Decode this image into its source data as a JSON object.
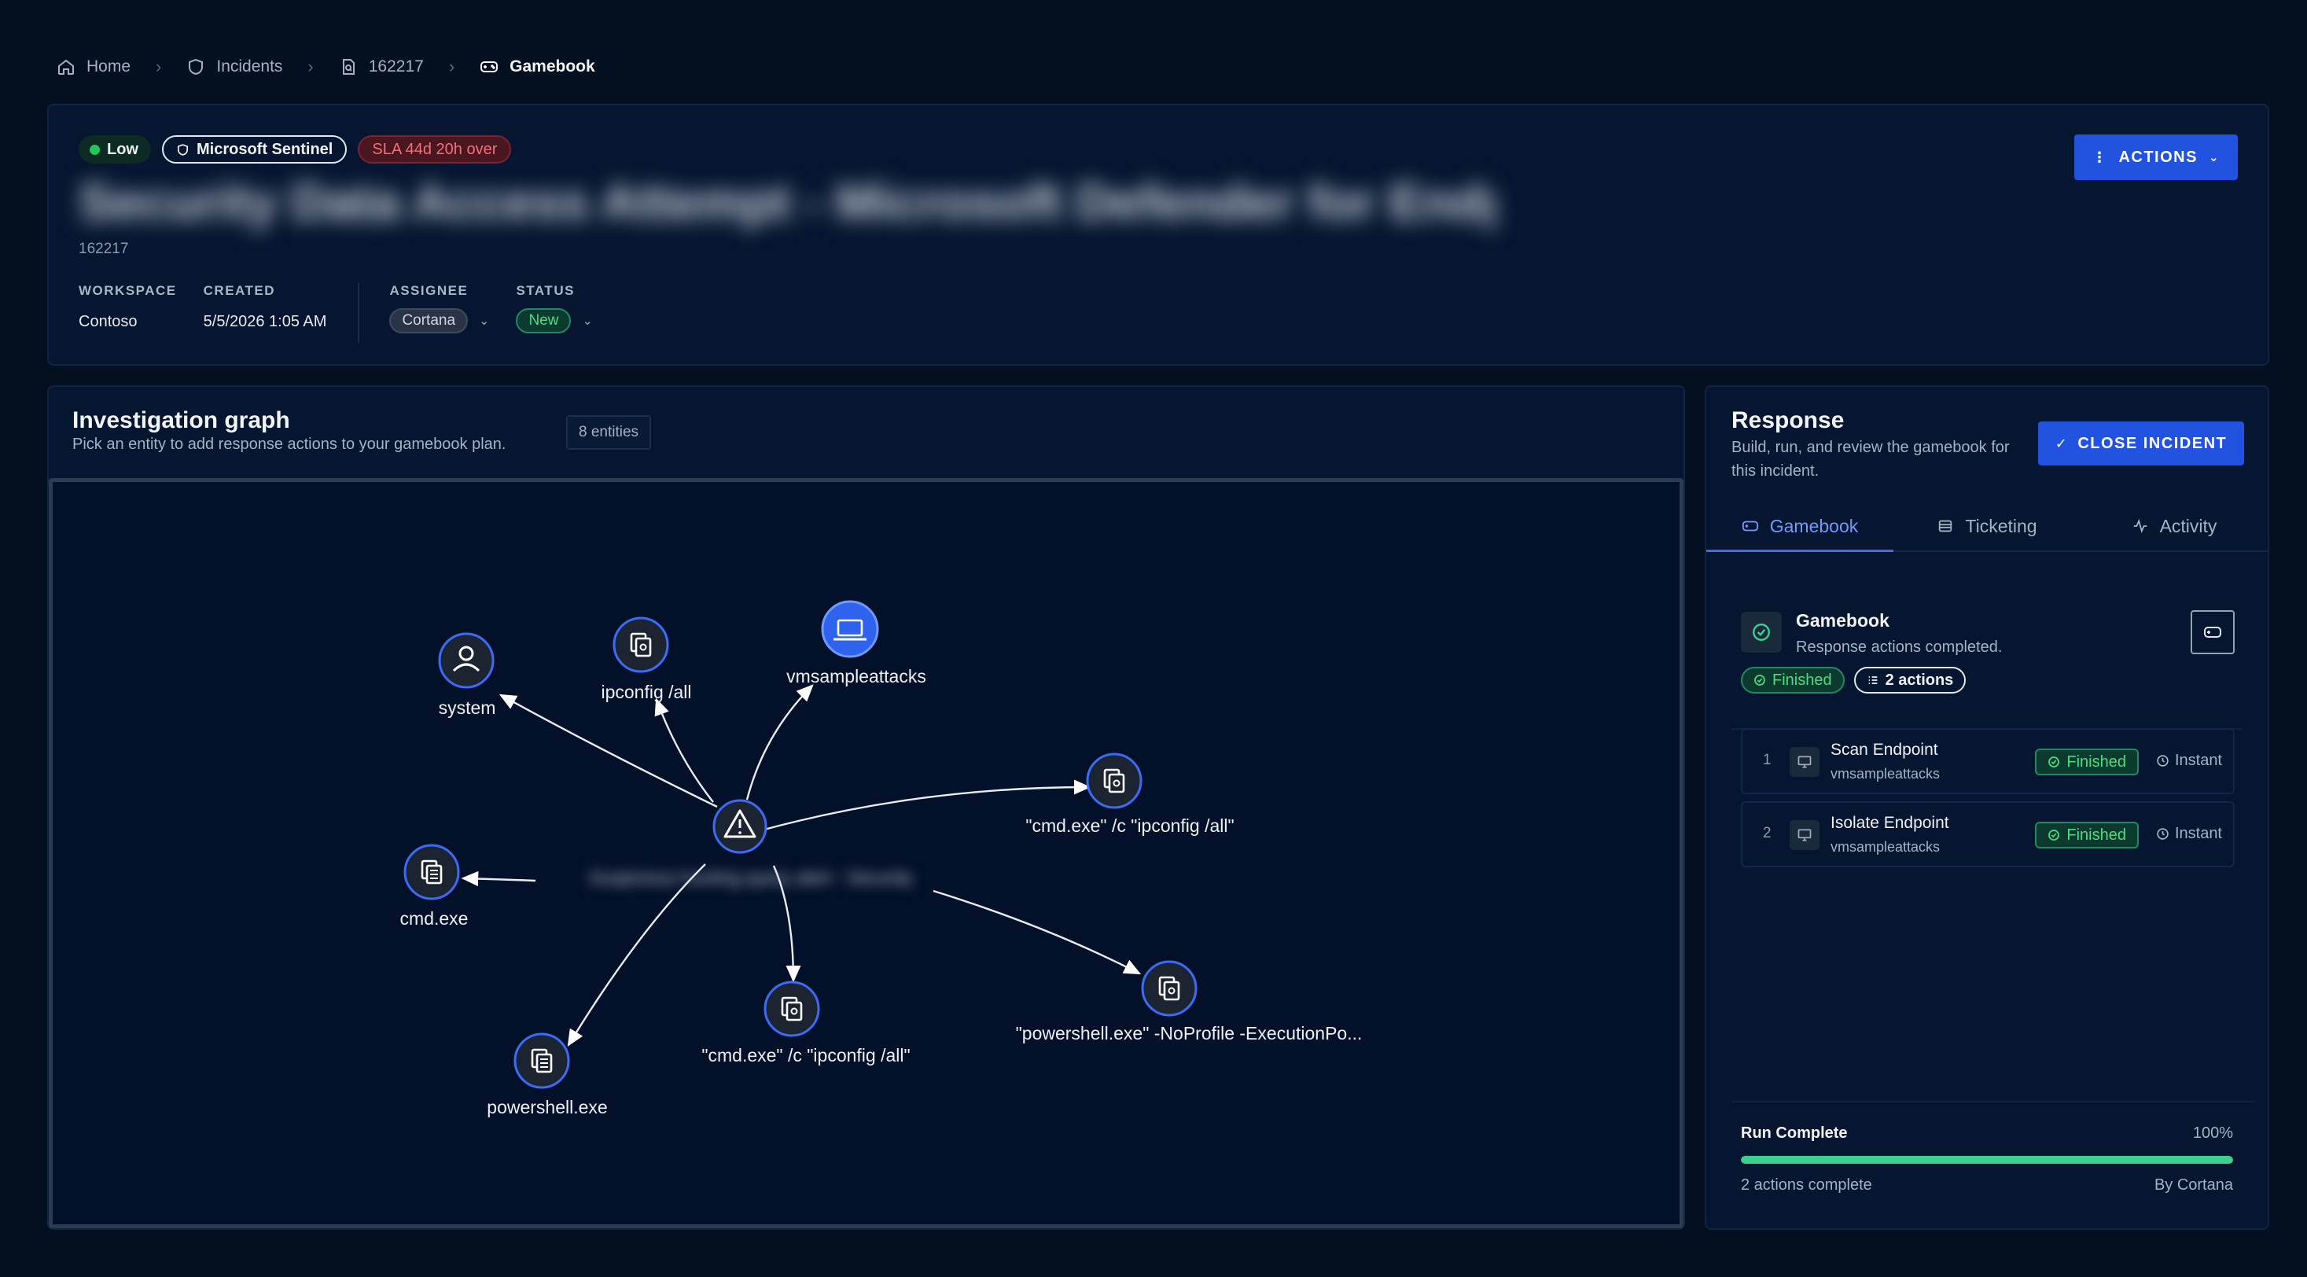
{
  "breadcrumb": {
    "home": "Home",
    "incidents": "Incidents",
    "incident_id": "162217",
    "current": "Gamebook"
  },
  "incident": {
    "severity": "Low",
    "source": "Microsoft Sentinel",
    "sla": "SLA 44d 20h over",
    "title": "Security Data Access Attempt - Microsoft Defender for Endpoint",
    "id": "162217",
    "workspace_label": "WORKSPACE",
    "workspace": "Contoso",
    "created_label": "CREATED",
    "created": "5/5/2026 1:05 AM",
    "assignee_label": "ASSIGNEE",
    "assignee": "Cortana",
    "status_label": "STATUS",
    "status": "New",
    "actions_label": "ACTIONS"
  },
  "graph": {
    "title": "Investigation graph",
    "subtitle": "Pick an entity to add response actions to your gamebook plan.",
    "entity_count": "8 entities",
    "center_label": "Suspicious hunting query alert - Security",
    "nodes": [
      {
        "id": "system",
        "label": "system",
        "kind": "user"
      },
      {
        "id": "ipconfig",
        "label": "ipconfig  /all",
        "kind": "process"
      },
      {
        "id": "vm",
        "label": "vmsampleattacks",
        "kind": "host"
      },
      {
        "id": "cmd-ipconfig-1",
        "label": "\"cmd.exe\" /c \"ipconfig /all\"",
        "kind": "process"
      },
      {
        "id": "cmd",
        "label": "cmd.exe",
        "kind": "file"
      },
      {
        "id": "powershell-np",
        "label": "\"powershell.exe\" -NoProfile -ExecutionPo...",
        "kind": "process"
      },
      {
        "id": "cmd-ipconfig-2",
        "label": "\"cmd.exe\" /c \"ipconfig /all\"",
        "kind": "process"
      },
      {
        "id": "powershell",
        "label": "powershell.exe",
        "kind": "file"
      }
    ]
  },
  "response": {
    "title": "Response",
    "subtitle": "Build, run, and review the gamebook for this incident.",
    "close_label": "CLOSE INCIDENT",
    "tabs": [
      {
        "label": "Gamebook",
        "icon": "gamepad-icon"
      },
      {
        "label": "Ticketing",
        "icon": "ticket-icon"
      },
      {
        "label": "Activity",
        "icon": "activity-icon"
      }
    ],
    "gamebook": {
      "name": "Gamebook",
      "description": "Response actions completed.",
      "status": "Finished",
      "count": "2 actions"
    },
    "actions": [
      {
        "num": "1",
        "name": "Scan Endpoint",
        "host": "vmsampleattacks",
        "status": "Finished",
        "time": "Instant"
      },
      {
        "num": "2",
        "name": "Isolate Endpoint",
        "host": "vmsampleattacks",
        "status": "Finished",
        "time": "Instant"
      }
    ],
    "run": {
      "title": "Run Complete",
      "percent_label": "100%",
      "progress": 1.0,
      "summary": "2 actions complete",
      "by": "By Cortana"
    }
  },
  "colors": {
    "accent": "#2252e0",
    "success": "#4ade80",
    "danger": "#f36f7a",
    "background": "#040f1f"
  }
}
